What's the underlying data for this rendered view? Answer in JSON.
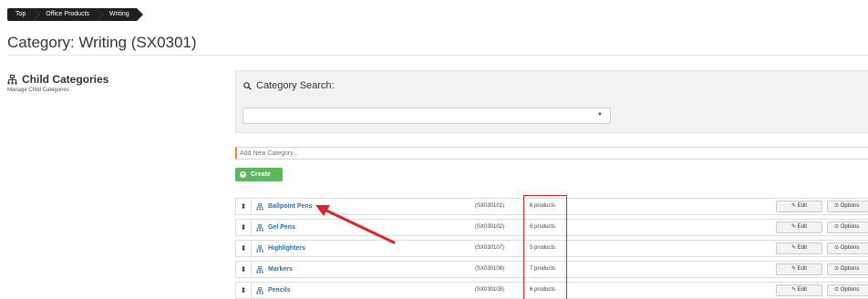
{
  "breadcrumb": [
    "Top",
    "Office Products",
    "Writing"
  ],
  "page_title": "Category: Writing (SX0301)",
  "child_categories": {
    "heading": "Child Categories",
    "subheading": "Manage Child Categories"
  },
  "search": {
    "title": "Category Search:",
    "selected_value": ""
  },
  "add_category": {
    "placeholder": "Add New Category...",
    "create_label": "Create"
  },
  "rows": [
    {
      "name": "Ballpoint Pens",
      "code": "(SX030101)",
      "count": "6 products"
    },
    {
      "name": "Gel Pens",
      "code": "(SX030102)",
      "count": "6 products"
    },
    {
      "name": "Highlighters",
      "code": "(SX030107)",
      "count": "5 products"
    },
    {
      "name": "Markers",
      "code": "(SX030106)",
      "count": "7 products"
    },
    {
      "name": "Pencils",
      "code": "(SX030105)",
      "count": "6 products"
    }
  ],
  "row_actions": {
    "edit_label": "Edit",
    "options_label": "Options"
  },
  "colors": {
    "link": "#2a6fad",
    "create": "#5cb85c",
    "annotation": "#d9242b"
  }
}
